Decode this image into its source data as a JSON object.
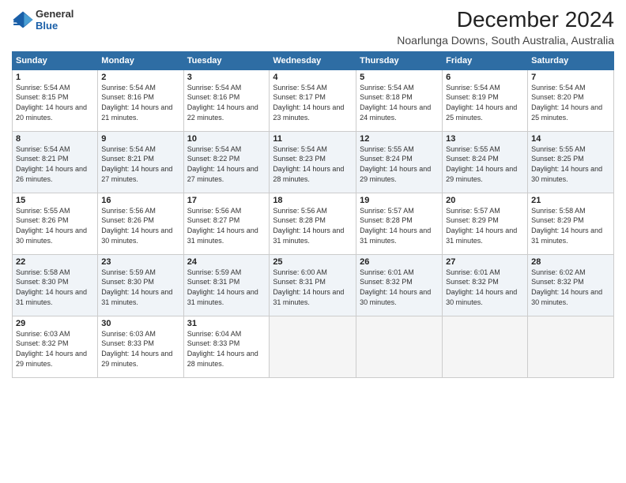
{
  "logo": {
    "line1": "General",
    "line2": "Blue"
  },
  "title": "December 2024",
  "subtitle": "Noarlunga Downs, South Australia, Australia",
  "weekdays": [
    "Sunday",
    "Monday",
    "Tuesday",
    "Wednesday",
    "Thursday",
    "Friday",
    "Saturday"
  ],
  "weeks": [
    [
      {
        "day": "1",
        "sunrise": "5:54 AM",
        "sunset": "8:15 PM",
        "daylight": "14 hours and 20 minutes."
      },
      {
        "day": "2",
        "sunrise": "5:54 AM",
        "sunset": "8:16 PM",
        "daylight": "14 hours and 21 minutes."
      },
      {
        "day": "3",
        "sunrise": "5:54 AM",
        "sunset": "8:16 PM",
        "daylight": "14 hours and 22 minutes."
      },
      {
        "day": "4",
        "sunrise": "5:54 AM",
        "sunset": "8:17 PM",
        "daylight": "14 hours and 23 minutes."
      },
      {
        "day": "5",
        "sunrise": "5:54 AM",
        "sunset": "8:18 PM",
        "daylight": "14 hours and 24 minutes."
      },
      {
        "day": "6",
        "sunrise": "5:54 AM",
        "sunset": "8:19 PM",
        "daylight": "14 hours and 25 minutes."
      },
      {
        "day": "7",
        "sunrise": "5:54 AM",
        "sunset": "8:20 PM",
        "daylight": "14 hours and 25 minutes."
      }
    ],
    [
      {
        "day": "8",
        "sunrise": "5:54 AM",
        "sunset": "8:21 PM",
        "daylight": "14 hours and 26 minutes."
      },
      {
        "day": "9",
        "sunrise": "5:54 AM",
        "sunset": "8:21 PM",
        "daylight": "14 hours and 27 minutes."
      },
      {
        "day": "10",
        "sunrise": "5:54 AM",
        "sunset": "8:22 PM",
        "daylight": "14 hours and 27 minutes."
      },
      {
        "day": "11",
        "sunrise": "5:54 AM",
        "sunset": "8:23 PM",
        "daylight": "14 hours and 28 minutes."
      },
      {
        "day": "12",
        "sunrise": "5:55 AM",
        "sunset": "8:24 PM",
        "daylight": "14 hours and 29 minutes."
      },
      {
        "day": "13",
        "sunrise": "5:55 AM",
        "sunset": "8:24 PM",
        "daylight": "14 hours and 29 minutes."
      },
      {
        "day": "14",
        "sunrise": "5:55 AM",
        "sunset": "8:25 PM",
        "daylight": "14 hours and 30 minutes."
      }
    ],
    [
      {
        "day": "15",
        "sunrise": "5:55 AM",
        "sunset": "8:26 PM",
        "daylight": "14 hours and 30 minutes."
      },
      {
        "day": "16",
        "sunrise": "5:56 AM",
        "sunset": "8:26 PM",
        "daylight": "14 hours and 30 minutes."
      },
      {
        "day": "17",
        "sunrise": "5:56 AM",
        "sunset": "8:27 PM",
        "daylight": "14 hours and 31 minutes."
      },
      {
        "day": "18",
        "sunrise": "5:56 AM",
        "sunset": "8:28 PM",
        "daylight": "14 hours and 31 minutes."
      },
      {
        "day": "19",
        "sunrise": "5:57 AM",
        "sunset": "8:28 PM",
        "daylight": "14 hours and 31 minutes."
      },
      {
        "day": "20",
        "sunrise": "5:57 AM",
        "sunset": "8:29 PM",
        "daylight": "14 hours and 31 minutes."
      },
      {
        "day": "21",
        "sunrise": "5:58 AM",
        "sunset": "8:29 PM",
        "daylight": "14 hours and 31 minutes."
      }
    ],
    [
      {
        "day": "22",
        "sunrise": "5:58 AM",
        "sunset": "8:30 PM",
        "daylight": "14 hours and 31 minutes."
      },
      {
        "day": "23",
        "sunrise": "5:59 AM",
        "sunset": "8:30 PM",
        "daylight": "14 hours and 31 minutes."
      },
      {
        "day": "24",
        "sunrise": "5:59 AM",
        "sunset": "8:31 PM",
        "daylight": "14 hours and 31 minutes."
      },
      {
        "day": "25",
        "sunrise": "6:00 AM",
        "sunset": "8:31 PM",
        "daylight": "14 hours and 31 minutes."
      },
      {
        "day": "26",
        "sunrise": "6:01 AM",
        "sunset": "8:32 PM",
        "daylight": "14 hours and 30 minutes."
      },
      {
        "day": "27",
        "sunrise": "6:01 AM",
        "sunset": "8:32 PM",
        "daylight": "14 hours and 30 minutes."
      },
      {
        "day": "28",
        "sunrise": "6:02 AM",
        "sunset": "8:32 PM",
        "daylight": "14 hours and 30 minutes."
      }
    ],
    [
      {
        "day": "29",
        "sunrise": "6:03 AM",
        "sunset": "8:32 PM",
        "daylight": "14 hours and 29 minutes."
      },
      {
        "day": "30",
        "sunrise": "6:03 AM",
        "sunset": "8:33 PM",
        "daylight": "14 hours and 29 minutes."
      },
      {
        "day": "31",
        "sunrise": "6:04 AM",
        "sunset": "8:33 PM",
        "daylight": "14 hours and 28 minutes."
      },
      null,
      null,
      null,
      null
    ]
  ]
}
